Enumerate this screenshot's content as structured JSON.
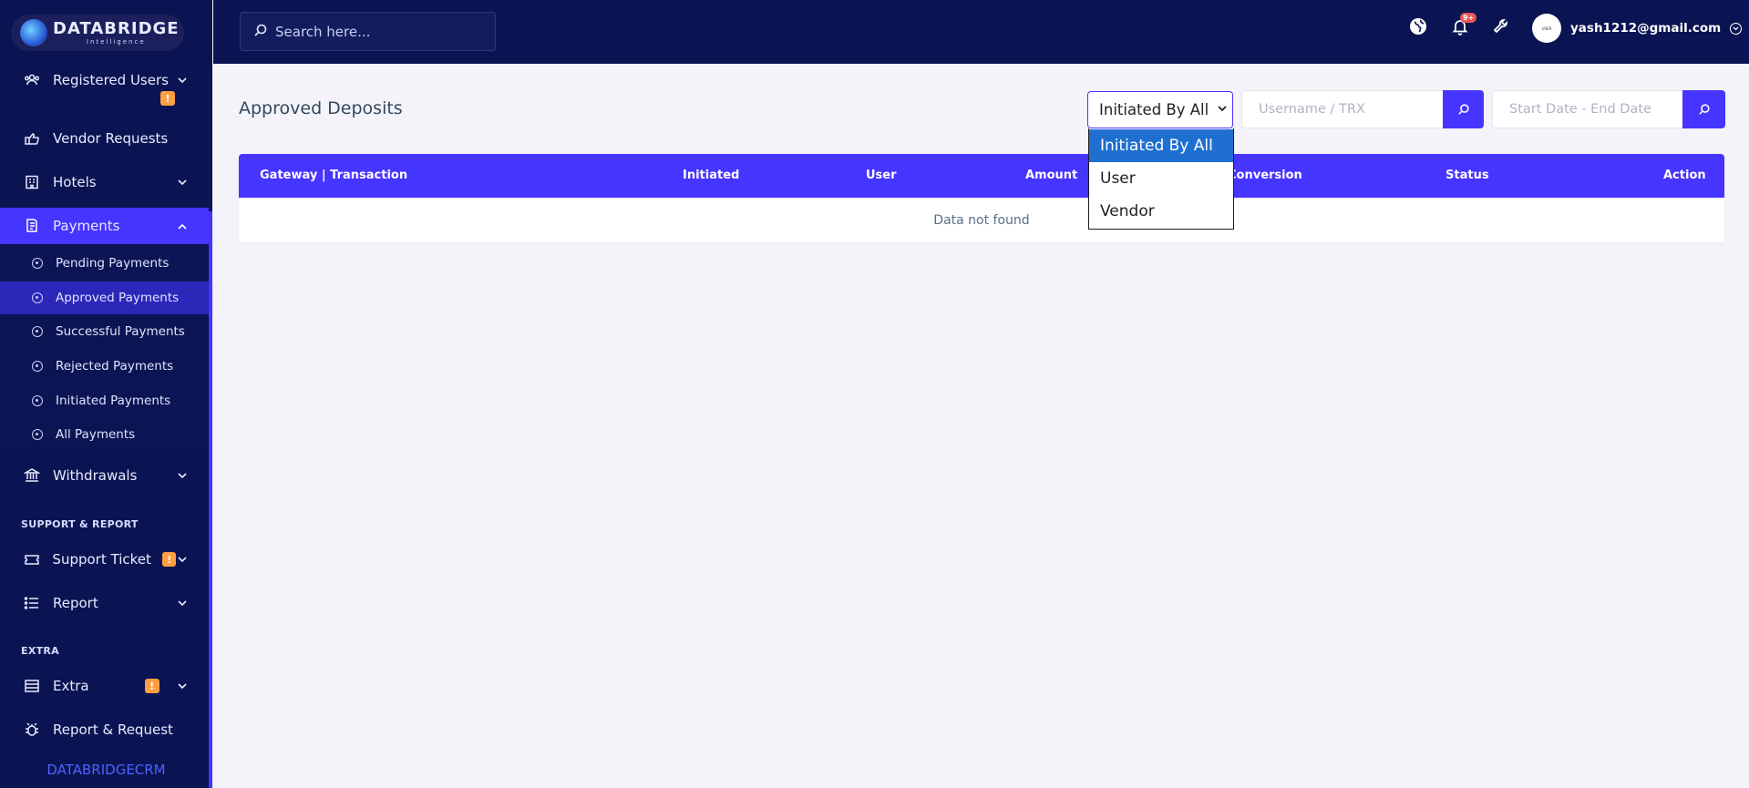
{
  "brand": {
    "name": "DATABRIDGE",
    "sub": "Intelligence"
  },
  "sidebar": {
    "items": [
      {
        "label": "Registered Users",
        "icon": "users-icon",
        "has_warning": true
      },
      {
        "label": "Vendor Requests",
        "icon": "vendor-icon"
      },
      {
        "label": "Hotels",
        "icon": "hotel-icon"
      },
      {
        "label": "Payments",
        "icon": "payments-icon",
        "active": true
      }
    ],
    "payments_submenu": [
      {
        "label": "Pending Payments"
      },
      {
        "label": "Approved Payments",
        "active": true
      },
      {
        "label": "Successful Payments"
      },
      {
        "label": "Rejected Payments"
      },
      {
        "label": "Initiated Payments"
      },
      {
        "label": "All Payments"
      }
    ],
    "withdrawals_label": "Withdrawals",
    "section_support": "SUPPORT & REPORT",
    "support_ticket_label": "Support Ticket",
    "report_label": "Report",
    "section_extra": "EXTRA",
    "extra_label": "Extra",
    "report_request_label": "Report & Request",
    "warning_mark": "!",
    "footer": "DATABRIDGECRM"
  },
  "topbar": {
    "search_placeholder": "Search here...",
    "notification_count": "9+",
    "user_email": "yash1212@gmail.com",
    "avatar_text": "USER"
  },
  "page": {
    "title": "Approved Deposits",
    "filter_selected": "Initiated By All",
    "filter_options": [
      "Initiated By All",
      "User",
      "Vendor"
    ],
    "search_placeholder": "Username / TRX",
    "date_placeholder": "Start Date - End Date"
  },
  "table": {
    "columns": [
      "Gateway | Transaction",
      "Initiated",
      "User",
      "Amount",
      "Conversion",
      "Status",
      "Action"
    ],
    "empty_message": "Data not found"
  },
  "colors": {
    "sidebar_bg": "#0b1452",
    "accent": "#4634ff",
    "warning": "#ff9f43",
    "danger": "#ea5455",
    "page_bg": "#f3f3f9"
  }
}
